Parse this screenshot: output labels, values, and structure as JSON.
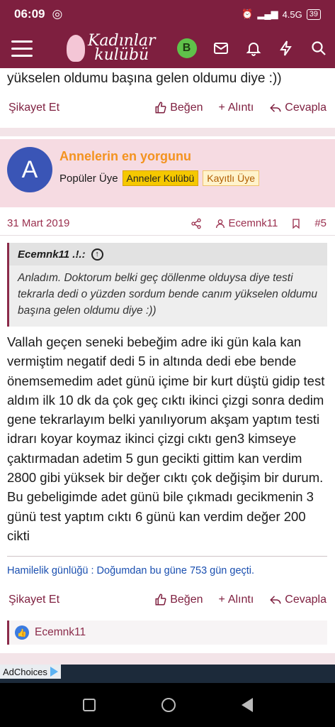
{
  "status_bar": {
    "time": "06:09",
    "network": "4.5G",
    "battery": "39"
  },
  "header": {
    "logo_line1": "Kadınlar",
    "logo_line2": "kulübü",
    "avatar_letter": "B"
  },
  "prev_post": {
    "tail_text": "yükselen oldumu başına gelen oldumu diye :))",
    "complain": "Şikayet Et",
    "like": "Beğen",
    "quote": "Alıntı",
    "reply": "Cevapla"
  },
  "post": {
    "user_initial": "A",
    "username": "Annelerin en yorgunu",
    "rank": "Popüler Üye",
    "tag1": "Anneler Kulübü",
    "tag2": "Kayıtlı Üye",
    "date": "31 Mart 2019",
    "reply_to": "Ecemnk11",
    "number": "#5",
    "quote_author": "Ecemnk11 .!.:",
    "quote_text": "Anladım. Doktorum belki geç döllenme olduysa diye testi tekrarla dedi o yüzden sordum bende canım yükselen oldumu başına gelen oldumu diye :))",
    "body": "Vallah geçen seneki bebeğim adre iki gün kala kan vermiştim negatif dedi 5 in altında dedi ebe bende önemsemedim adet günü içime bir kurt düştü gidip test aldım ilk 10 dk da çok geç cıktı ikinci çizgi sonra dedim gene tekrarlayım belki yanılıyorum akşam yaptım testi idrarı koyar koymaz ikinci çizgi cıktı gen3 kimseye çaktırmadan adetim 5 gun gecikti gittim kan verdim 2800 gibi yüksek bir değer cıktı çok değişim bir durum. Bu gebeligimde adet günü bile çıkmadı gecikmenin 3 günü test yaptım cıktı 6 günü kan verdim değer 200 cikti",
    "signature": "Hamilelik günlüğü : Doğumdan bu güne 753 gün geçti.",
    "complain": "Şikayet Et",
    "like": "Beğen",
    "quote": "Alıntı",
    "reply": "Cevapla",
    "liked_by": "Ecemnk11"
  },
  "ad": {
    "label": "AdChoices"
  },
  "colors": {
    "brand": "#7e1f3f",
    "username": "#f39320",
    "signature": "#1a4fb0"
  }
}
